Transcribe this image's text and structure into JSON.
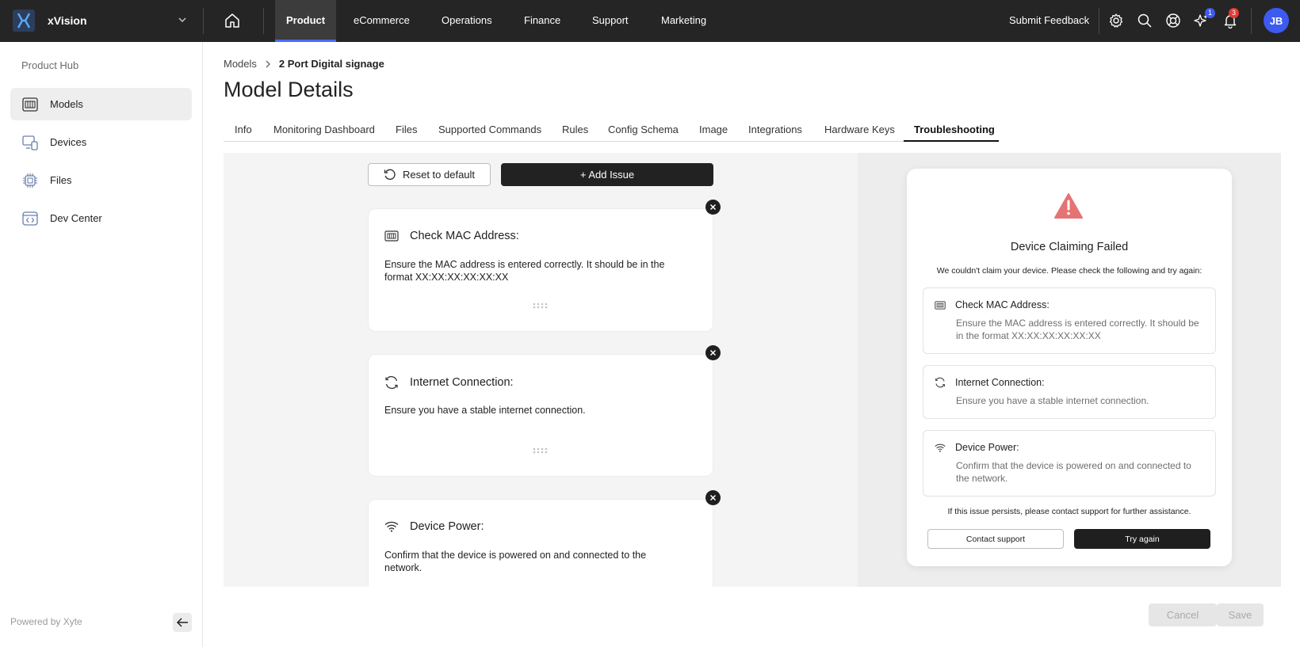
{
  "app": {
    "name": "xVision"
  },
  "topnav": {
    "tabs": [
      "Product",
      "eCommerce",
      "Operations",
      "Finance",
      "Support",
      "Marketing"
    ],
    "active_tab": "Product",
    "feedback_label": "Submit Feedback",
    "sparkle_badge": "1",
    "notification_badge": "3",
    "avatar_initials": "JB",
    "colors": {
      "bar": "#252525",
      "accent": "#4a6cf7",
      "badge_blue": "#3d5af1",
      "badge_red": "#e53935"
    }
  },
  "sidebar": {
    "heading": "Product Hub",
    "items": [
      {
        "label": "Models",
        "icon": "model-icon",
        "active": true
      },
      {
        "label": "Devices",
        "icon": "devices-icon",
        "active": false
      },
      {
        "label": "Files",
        "icon": "chip-icon",
        "active": false
      },
      {
        "label": "Dev Center",
        "icon": "code-icon",
        "active": false
      }
    ],
    "footer": "Powered by Xyte"
  },
  "breadcrumb": {
    "parent": "Models",
    "current": "2 Port Digital signage"
  },
  "page": {
    "title": "Model Details"
  },
  "tabs": {
    "items": [
      "Info",
      "Monitoring Dashboard",
      "Files",
      "Supported Commands",
      "Rules",
      "Config Schema",
      "Image",
      "Integrations",
      "Hardware Keys",
      "Troubleshooting"
    ],
    "active": "Troubleshooting"
  },
  "editor": {
    "reset_label": "Reset to default",
    "add_label": "+ Add Issue",
    "issues": [
      {
        "title": "Check MAC Address:",
        "body": "Ensure the MAC address is entered correctly. It should be in the format XX:XX:XX:XX:XX:XX",
        "icon": "mac-address-icon"
      },
      {
        "title": "Internet Connection:",
        "body": "Ensure you have a stable internet connection.",
        "icon": "connection-icon"
      },
      {
        "title": "Device Power:",
        "body": "Confirm that the device is powered on and connected to the network.",
        "icon": "wifi-icon"
      }
    ]
  },
  "preview": {
    "title": "Device Claiming Failed",
    "subtitle": "We couldn't claim your device. Please check the following and try again:",
    "items": [
      {
        "title": "Check MAC Address:",
        "body": "Ensure the MAC address is entered correctly. It should be in the format XX:XX:XX:XX:XX:XX"
      },
      {
        "title": "Internet Connection:",
        "body": "Ensure you have a stable internet connection."
      },
      {
        "title": "Device Power:",
        "body": "Confirm that the device is powered on and connected to the network."
      }
    ],
    "footer": "If this issue persists, please contact support for further assistance.",
    "contact_label": "Contact support",
    "retry_label": "Try again",
    "warning_color": "#e57373"
  },
  "footer_actions": {
    "cancel_label": "Cancel",
    "save_label": "Save"
  }
}
